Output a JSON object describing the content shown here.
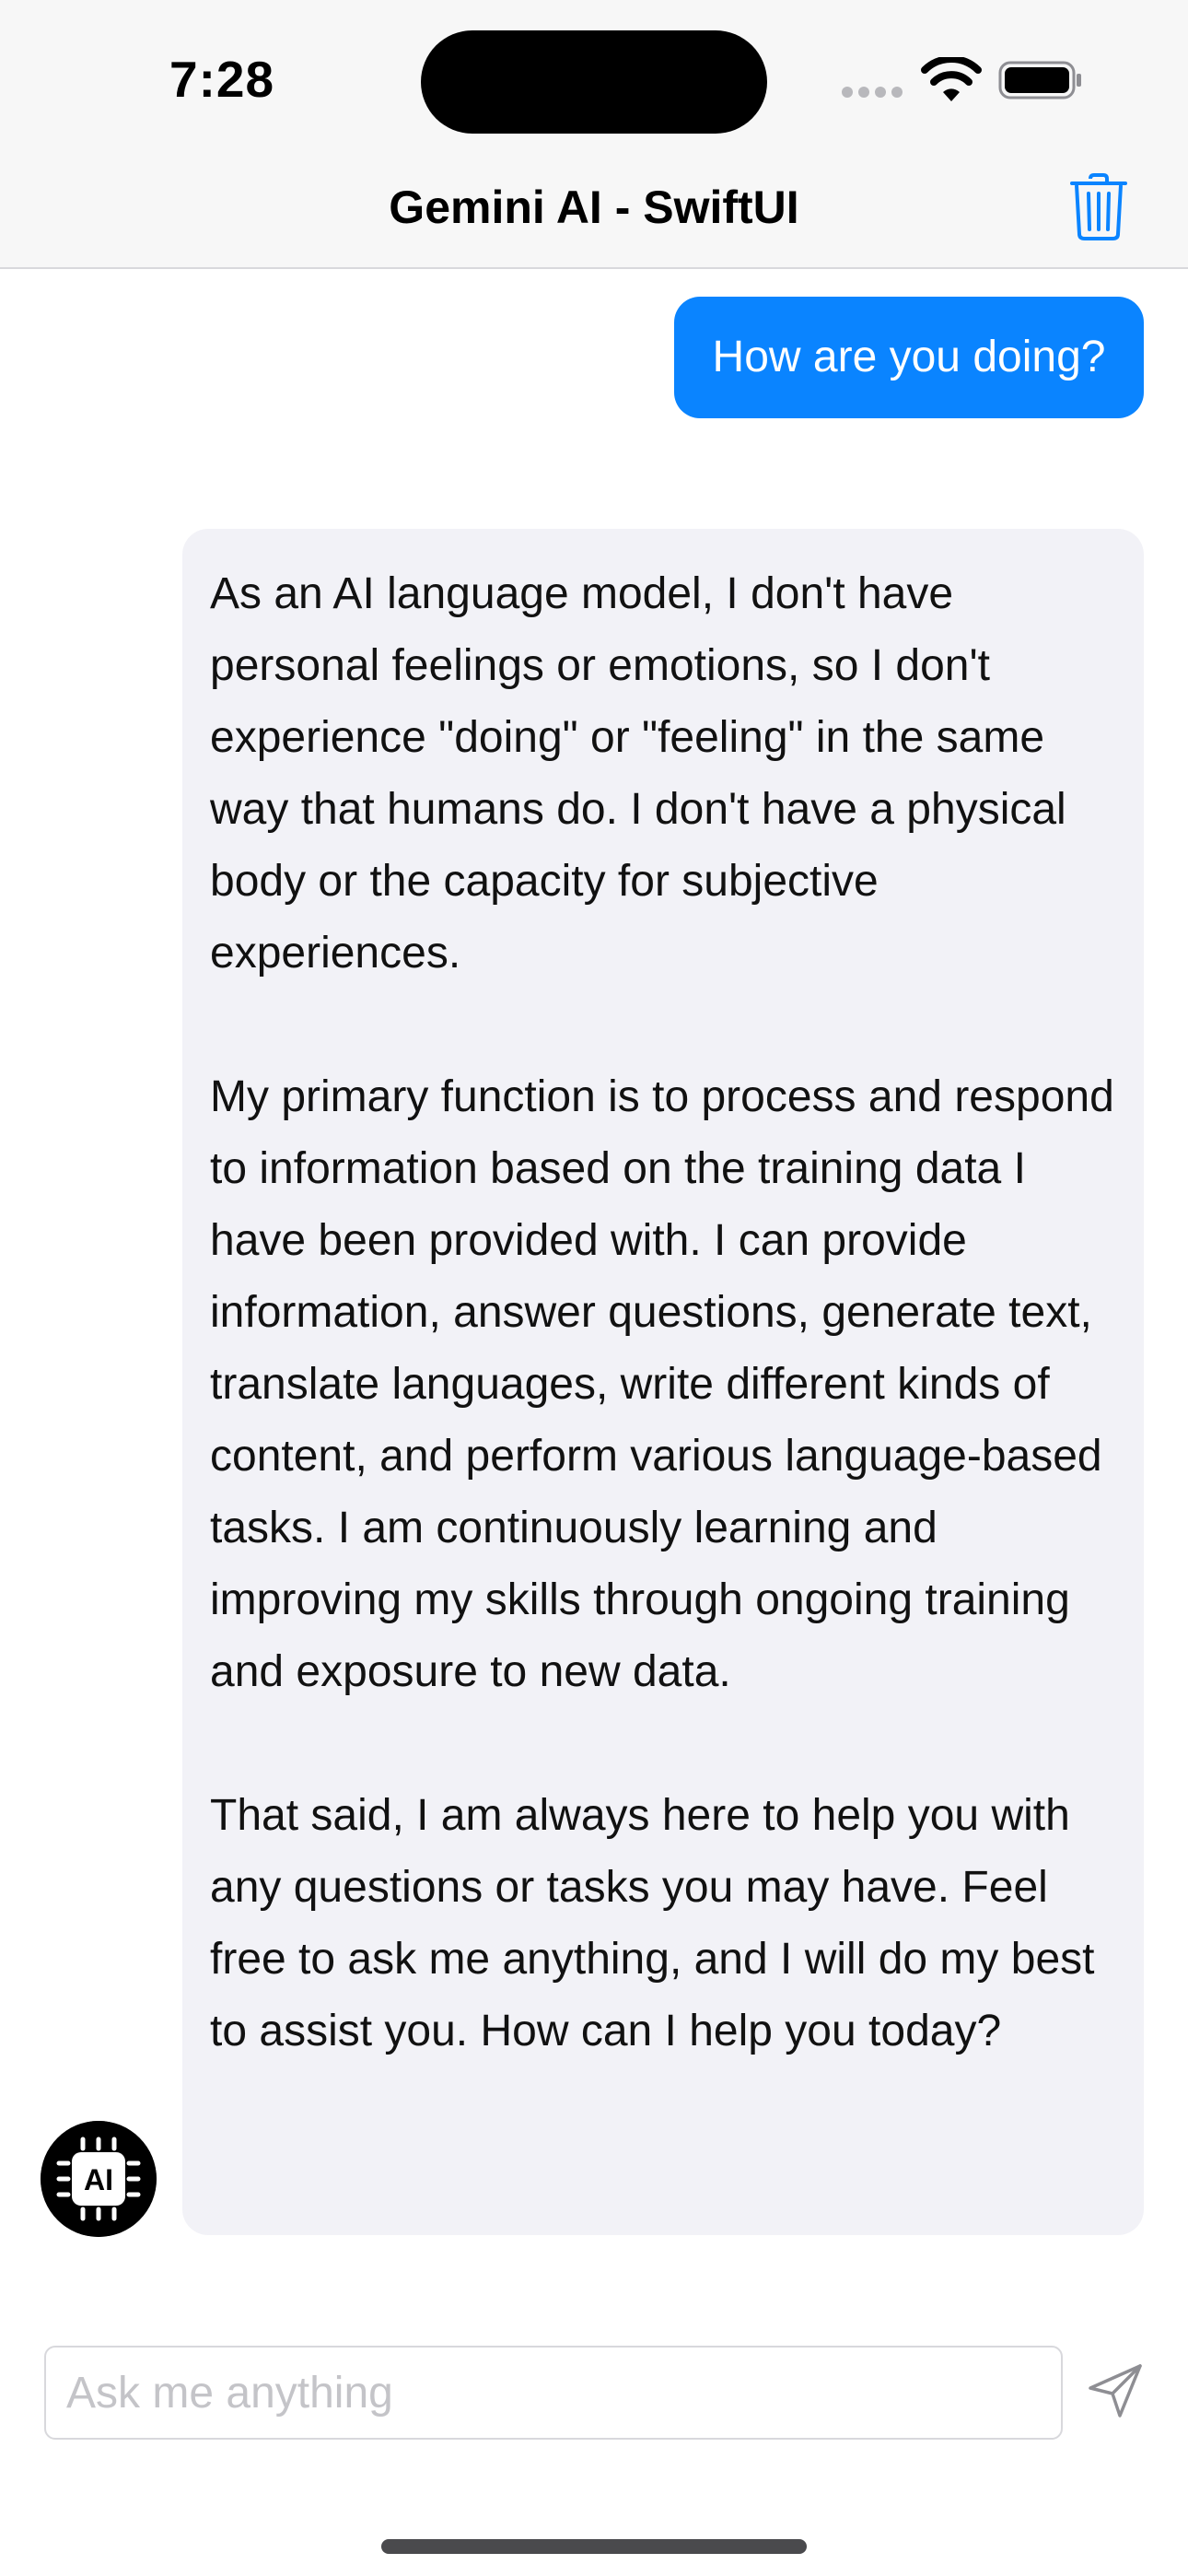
{
  "status_bar": {
    "time": "7:28"
  },
  "nav": {
    "title": "Gemini AI - SwiftUI",
    "trash_icon": "trash-icon"
  },
  "messages": [
    {
      "role": "user",
      "text": "How are you doing?"
    },
    {
      "role": "ai",
      "avatar_text": "AI",
      "paragraphs": [
        "As an AI language model, I don't have personal feelings or emotions, so I don't experience \"doing\" or \"feeling\" in the same way that humans do. I don't have a physical body or the capacity for subjective experiences.",
        "My primary function is to process and respond to information based on the training data I have been provided with. I can provide information, answer questions, generate text, translate languages, write different kinds of content, and perform various language-based tasks. I am continuously learning and improving my skills through ongoing training and exposure to new data.",
        "That said, I am always here to help you with any questions or tasks you may have. Feel free to ask me anything, and I will do my best to assist you. How can I help you today?"
      ]
    }
  ],
  "composer": {
    "placeholder": "Ask me anything",
    "value": "",
    "send_icon": "paper-plane-icon"
  },
  "colors": {
    "accent": "#0a84ff",
    "ai_bubble": "#f2f2f7",
    "placeholder": "#c4c4c8"
  }
}
